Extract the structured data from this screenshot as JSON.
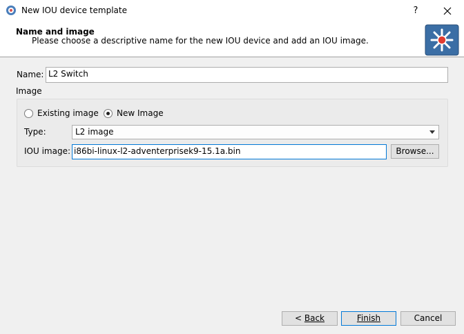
{
  "window": {
    "title": "New IOU device template",
    "help_label": "?"
  },
  "header": {
    "title": "Name and image",
    "subtitle": "Please choose a descriptive name for the new IOU device and add an IOU image."
  },
  "form": {
    "name_label": "Name:",
    "name_value": "L2 Switch",
    "image_label": "Image",
    "radio_existing": "Existing image",
    "radio_new": "New Image",
    "radio_selected": "new",
    "type_label": "Type:",
    "type_value": "L2 image",
    "iou_label": "IOU image:",
    "iou_value": "i86bi-linux-l2-adventerprisek9-15.1a.bin",
    "browse_label": "Browse..."
  },
  "footer": {
    "back_label": "Back",
    "finish_label": "Finish",
    "cancel_label": "Cancel"
  },
  "colors": {
    "accent": "#0078d7",
    "logo_bg": "#3b6ea5"
  },
  "icons": {
    "app": "gns3-icon",
    "close": "close-icon",
    "header": "multilayer-switch-icon",
    "dropdown": "chevron-down-icon"
  }
}
